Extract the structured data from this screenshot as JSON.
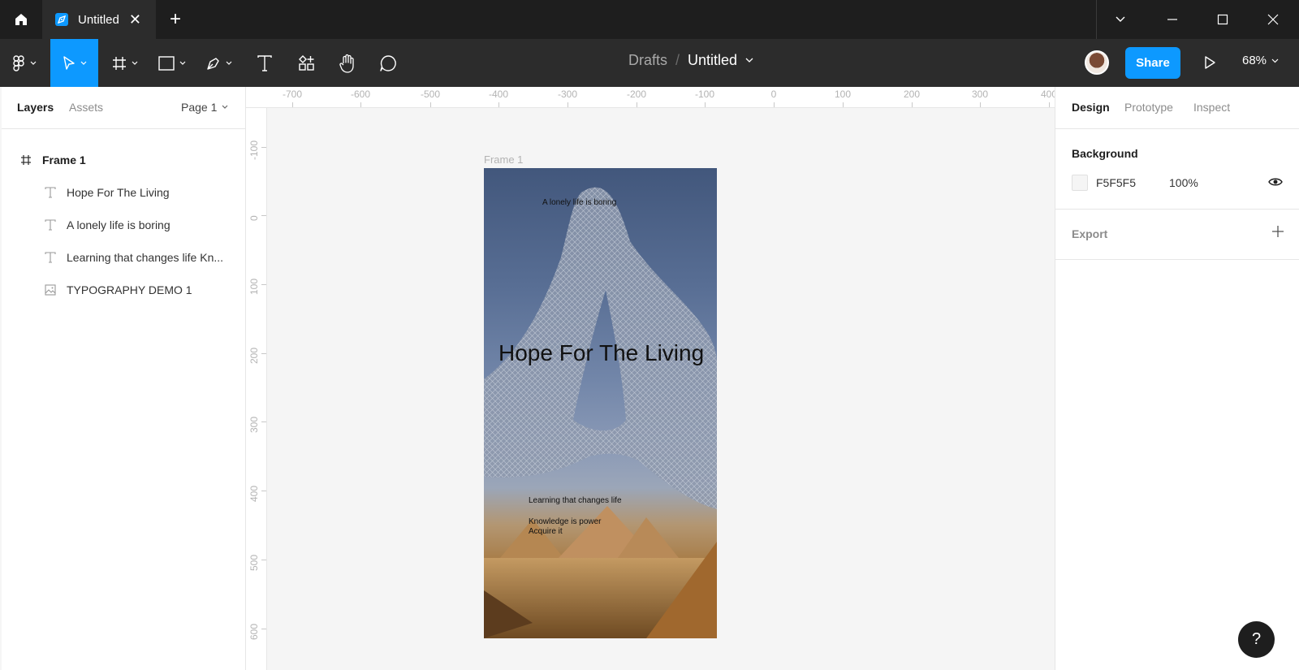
{
  "titlebar": {
    "tab_label": "Untitled"
  },
  "toolbar": {
    "breadcrumb_drafts": "Drafts",
    "breadcrumb_sep": "/",
    "file_title": "Untitled",
    "share_label": "Share",
    "zoom": "68%"
  },
  "left_panel": {
    "tab_layers": "Layers",
    "tab_assets": "Assets",
    "page": "Page 1",
    "layers": [
      {
        "label": "Frame 1",
        "icon": "frame-icon"
      },
      {
        "label": "Hope For The Living",
        "icon": "text-icon"
      },
      {
        "label": "A lonely life is boring",
        "icon": "text-icon"
      },
      {
        "label": "Learning that changes life Kn...",
        "icon": "text-icon"
      },
      {
        "label": "TYPOGRAPHY DEMO 1",
        "icon": "image-icon"
      }
    ]
  },
  "rulers": {
    "x_labels": [
      "-700",
      "-600",
      "-500",
      "-400",
      "-300",
      "-200",
      "-100",
      "0",
      "100",
      "200",
      "300",
      "400"
    ],
    "y_labels": [
      "-100",
      "0",
      "100",
      "200",
      "300",
      "400",
      "500",
      "600"
    ]
  },
  "canvas": {
    "frame_label": "Frame 1",
    "text_top": "A lonely life is boring",
    "text_headline": "Hope For The Living",
    "text_learning": "Learning that changes life",
    "text_knowledge": "Knowledge is power",
    "text_acquire": "Acquire it"
  },
  "right_panel": {
    "tab_design": "Design",
    "tab_prototype": "Prototype",
    "tab_inspect": "Inspect",
    "background_title": "Background",
    "bg_hex": "F5F5F5",
    "bg_opacity": "100%",
    "export_title": "Export"
  },
  "help_label": "?",
  "colors": {
    "accent": "#0d99ff",
    "titlebar": "#1e1e1e",
    "toolbar": "#2c2c2c",
    "canvas": "#f5f5f5"
  }
}
